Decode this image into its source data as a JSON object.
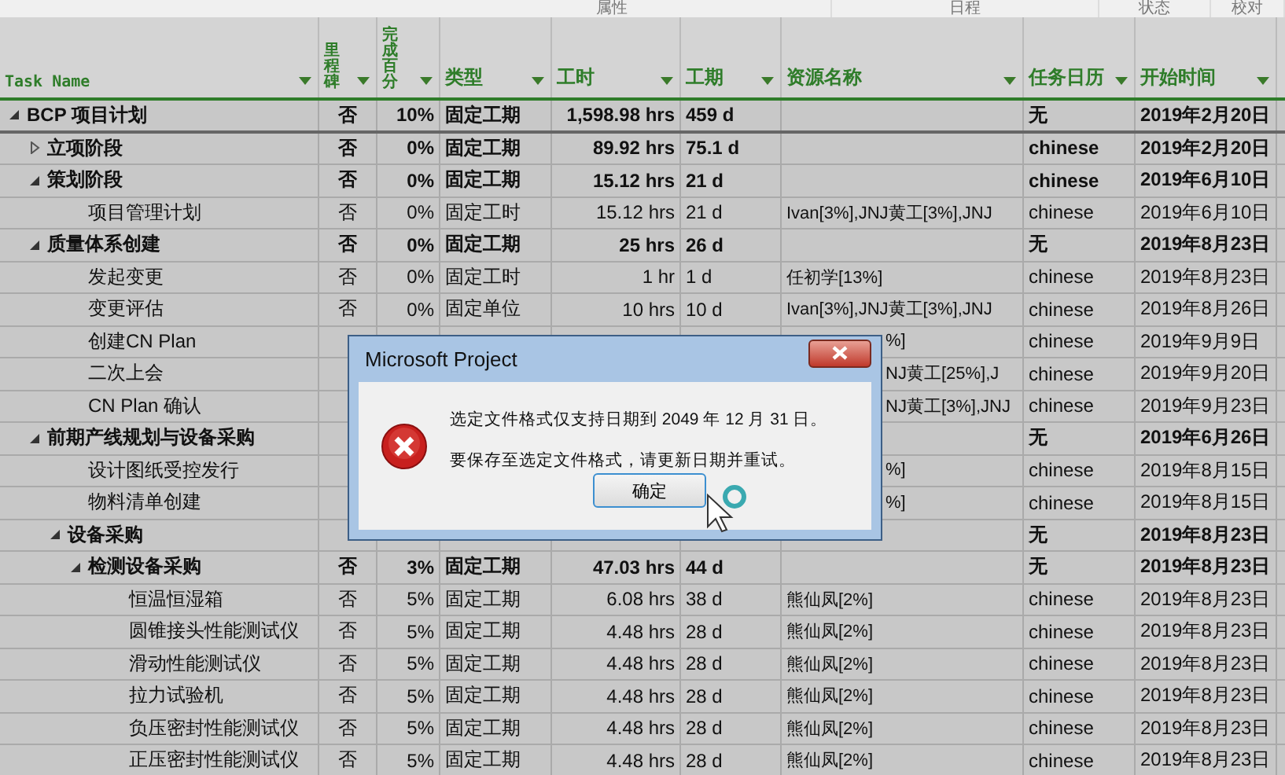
{
  "groups": [
    "属性",
    "日程",
    "状态",
    "校对"
  ],
  "columns": [
    {
      "label": "Task Name",
      "vertical": false
    },
    {
      "label": "里程碑",
      "vertical": true
    },
    {
      "label": "完成百分",
      "vertical": true
    },
    {
      "label": "类型",
      "vertical": false
    },
    {
      "label": "工时",
      "vertical": false
    },
    {
      "label": "工期",
      "vertical": false
    },
    {
      "label": "资源名称",
      "vertical": false
    },
    {
      "label": "任务日历",
      "vertical": false
    },
    {
      "label": "开始时间",
      "vertical": false
    }
  ],
  "rows": [
    {
      "kind": "summary",
      "expanded": true,
      "name": "BCP 项目计划",
      "milestone": "否",
      "percent": "10%",
      "type": "固定工期",
      "work": "1,598.98 hrs",
      "duration": "459 d",
      "calendar": "无",
      "start": "2019年2月20日",
      "children": [
        {
          "kind": "summary",
          "expanded": false,
          "name": "立项阶段",
          "milestone": "否",
          "percent": "0%",
          "type": "固定工期",
          "work": "89.92 hrs",
          "duration": "75.1 d",
          "calendar": "chinese",
          "start": "2019年2月20日"
        },
        {
          "kind": "summary",
          "expanded": true,
          "name": "策划阶段",
          "milestone": "否",
          "percent": "0%",
          "type": "固定工期",
          "work": "15.12 hrs",
          "duration": "21 d",
          "calendar": "chinese",
          "start": "2019年6月10日",
          "children": [
            {
              "kind": "task",
              "name": "项目管理计划",
              "milestone": "否",
              "percent": "0%",
              "type": "固定工时",
              "work": "15.12 hrs",
              "duration": "21 d",
              "resource": "Ivan[3%],JNJ黄工[3%],JNJ",
              "calendar": "chinese",
              "start": "2019年6月10日"
            }
          ]
        },
        {
          "kind": "summary",
          "expanded": true,
          "name": "质量体系创建",
          "milestone": "否",
          "percent": "0%",
          "type": "固定工期",
          "work": "25 hrs",
          "duration": "26 d",
          "calendar": "无",
          "start": "2019年8月23日",
          "children": [
            {
              "kind": "task",
              "name": "发起变更",
              "milestone": "否",
              "percent": "0%",
              "type": "固定工时",
              "work": "1 hr",
              "duration": "1 d",
              "resource": "任初学[13%]",
              "calendar": "chinese",
              "start": "2019年8月23日"
            },
            {
              "kind": "task",
              "name": "变更评估",
              "milestone": "否",
              "percent": "0%",
              "type": "固定单位",
              "work": "10 hrs",
              "duration": "10 d",
              "resource": "Ivan[3%],JNJ黄工[3%],JNJ",
              "calendar": "chinese",
              "start": "2019年8月26日"
            },
            {
              "kind": "task",
              "covered": true,
              "name": "创建CN Plan",
              "resource": "%]",
              "calendar": "chinese",
              "start": "2019年9月9日"
            },
            {
              "kind": "task",
              "covered": true,
              "name": "二次上会",
              "resource": "NJ黄工[25%],J",
              "calendar": "chinese",
              "start": "2019年9月20日"
            },
            {
              "kind": "task",
              "covered": true,
              "name": "CN Plan 确认",
              "resource": "NJ黄工[3%],JNJ",
              "calendar": "chinese",
              "start": "2019年9月23日"
            }
          ]
        },
        {
          "kind": "summary",
          "expanded": true,
          "name": "前期产线规划与设备采购",
          "calendar": "无",
          "start": "2019年6月26日",
          "children": [
            {
              "kind": "task",
              "covered": true,
              "name": "设计图纸受控发行",
              "resource": "%]",
              "calendar": "chinese",
              "start": "2019年8月15日"
            },
            {
              "kind": "task",
              "covered": true,
              "name": "物料清单创建",
              "resource": "%]",
              "calendar": "chinese",
              "start": "2019年8月15日"
            },
            {
              "kind": "summary",
              "expanded": true,
              "name": "设备采购",
              "calendar": "无",
              "start": "2019年8月23日",
              "children": [
                {
                  "kind": "summary",
                  "expanded": true,
                  "name": "检测设备采购",
                  "milestone": "否",
                  "percent": "3%",
                  "type": "固定工期",
                  "work": "47.03 hrs",
                  "duration": "44 d",
                  "calendar": "无",
                  "start": "2019年8月23日",
                  "children": [
                    {
                      "kind": "task",
                      "name": "恒温恒湿箱",
                      "milestone": "否",
                      "percent": "5%",
                      "type": "固定工期",
                      "work": "6.08 hrs",
                      "duration": "38 d",
                      "resource": "熊仙凤[2%]",
                      "calendar": "chinese",
                      "start": "2019年8月23日"
                    },
                    {
                      "kind": "task",
                      "name": "圆锥接头性能测试仪",
                      "milestone": "否",
                      "percent": "5%",
                      "type": "固定工期",
                      "work": "4.48 hrs",
                      "duration": "28 d",
                      "resource": "熊仙凤[2%]",
                      "calendar": "chinese",
                      "start": "2019年8月23日"
                    },
                    {
                      "kind": "task",
                      "name": "滑动性能测试仪",
                      "milestone": "否",
                      "percent": "5%",
                      "type": "固定工期",
                      "work": "4.48 hrs",
                      "duration": "28 d",
                      "resource": "熊仙凤[2%]",
                      "calendar": "chinese",
                      "start": "2019年8月23日"
                    },
                    {
                      "kind": "task",
                      "name": "拉力试验机",
                      "milestone": "否",
                      "percent": "5%",
                      "type": "固定工期",
                      "work": "4.48 hrs",
                      "duration": "28 d",
                      "resource": "熊仙凤[2%]",
                      "calendar": "chinese",
                      "start": "2019年8月23日"
                    },
                    {
                      "kind": "task",
                      "name": "负压密封性能测试仪",
                      "milestone": "否",
                      "percent": "5%",
                      "type": "固定工期",
                      "work": "4.48 hrs",
                      "duration": "28 d",
                      "resource": "熊仙凤[2%]",
                      "calendar": "chinese",
                      "start": "2019年8月23日"
                    },
                    {
                      "kind": "task",
                      "name": "正压密封性能测试仪",
                      "milestone": "否",
                      "percent": "5%",
                      "type": "固定工期",
                      "work": "4.48 hrs",
                      "duration": "28 d",
                      "resource": "熊仙凤[2%]",
                      "calendar": "chinese",
                      "start": "2019年8月23日"
                    }
                  ]
                }
              ]
            }
          ]
        }
      ]
    }
  ],
  "dialog": {
    "title": "Microsoft Project",
    "messages": [
      "选定文件格式仅支持日期到 2049 年 12 月 31 日。",
      "要保存至选定文件格式，请更新日期并重试。"
    ],
    "button": "确定"
  }
}
